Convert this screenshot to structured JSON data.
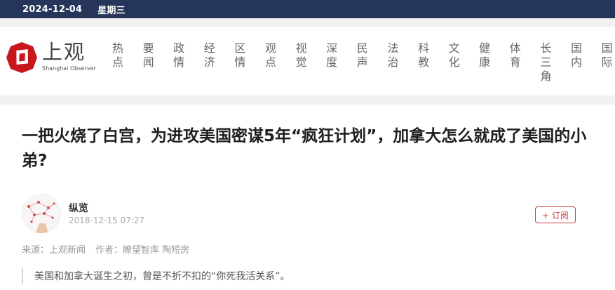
{
  "topbar": {
    "date": "2024-12-04",
    "weekday": "星期三"
  },
  "logo": {
    "cn": "上观",
    "en": "Shanghai Observer"
  },
  "nav": [
    "热点",
    "要闻",
    "政情",
    "经济",
    "区情",
    "观点",
    "视觉",
    "深度",
    "民声",
    "法治",
    "科教",
    "文化",
    "健康",
    "体育",
    "长三角",
    "国内",
    "国际"
  ],
  "article": {
    "title": "一把火烧了白宫，为进攻美国密谋5年“疯狂计划”，加拿大怎么就成了美国的小弟?",
    "author": "纵览",
    "datetime": "2018-12-15 07:27",
    "subscribe": "+ 订阅",
    "source": "来源：上观新闻",
    "writer": "作者：瞭望智库 陶短房",
    "lead": "美国和加拿大诞生之初，曾是不折不扣的“你死我活关系”。"
  },
  "colors": {
    "topbar": "#25365a",
    "logo_red": "#c8161d",
    "accent": "#cc3d3d"
  }
}
